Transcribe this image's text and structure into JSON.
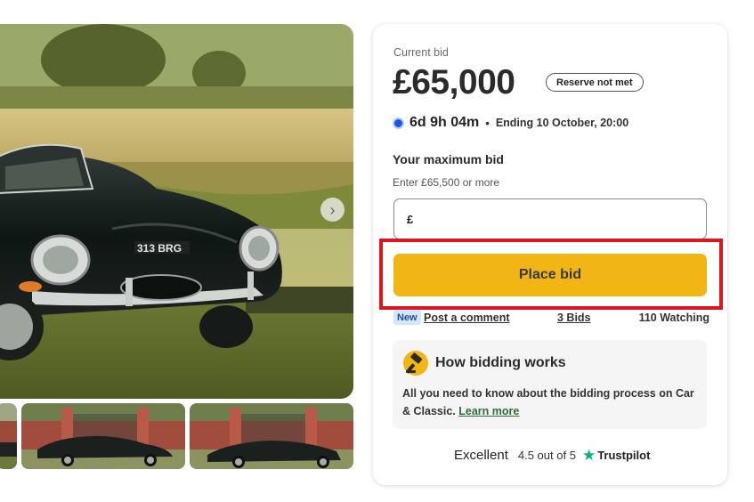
{
  "gallery": {
    "main_image_label": "313 BRG",
    "next_icon": "chevron-right-icon"
  },
  "bid_card": {
    "current_bid_label": "Current bid",
    "current_bid_amount": "£65,000",
    "reserve_badge": "Reserve not met",
    "time_left": "6d 9h 04m",
    "separator": "•",
    "ending": "Ending 10 October, 20:00",
    "max_bid_label": "Your maximum bid",
    "bid_hint": "Enter £65,500 or more",
    "currency_symbol": "£",
    "bid_input_value": "",
    "place_bid_label": "Place bid",
    "new_badge": "New",
    "post_comment": "Post a comment",
    "bids_count": "3 Bids",
    "watching": "110 Watching",
    "info_title": "How bidding works",
    "info_body": "All you need to know about the bidding process on Car & Classic.",
    "learn_more": "Learn more",
    "trust_excellent": "Excellent",
    "trust_rating": "4.5 out of 5",
    "trust_star": "★",
    "trust_name": "Trustpilot"
  },
  "colors": {
    "accent_yellow": "#f1b516",
    "timer_blue": "#1a56e6",
    "highlight_red": "#e0141e",
    "trustpilot_green": "#00b67a",
    "link_green": "#2e6a3a"
  }
}
